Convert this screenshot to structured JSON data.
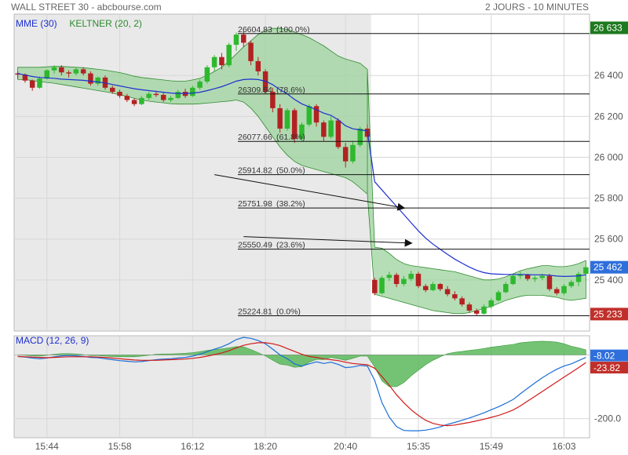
{
  "header": {
    "title": "WALL STREET 30 - abcbourse.com",
    "period": "2 JOURS - 10 MINUTES"
  },
  "colors": {
    "up": "#2eb82e",
    "down": "#b22222",
    "ema": "#1e2fd1",
    "keltner": "#2e8b2e",
    "keltner_fill": "#9ed39e",
    "macd": "#1a6fd6",
    "signal": "#d11a1a",
    "hist": "#5cb85c",
    "shade": "#e9e9e9",
    "last_price_bg": "#2e6fdc",
    "fib_top_bg": "#1e7a1e",
    "fib_bottom_bg": "#c0302a"
  },
  "chart_data": [
    {
      "type": "candlestick",
      "legend": [
        {
          "label": "MME (30)",
          "color": "#1e2fd1"
        },
        {
          "label": "KELTNER (20, 2)",
          "color": "#2e8b2e"
        }
      ],
      "ylim": [
        25150,
        26700
      ],
      "y_ticks": [
        {
          "value": 26400,
          "label": "26 400"
        },
        {
          "value": 26200,
          "label": "26 200"
        },
        {
          "value": 26000,
          "label": "26 000"
        },
        {
          "value": 25800,
          "label": "25 800"
        },
        {
          "value": 25600,
          "label": "25 600"
        },
        {
          "value": 25400,
          "label": "25 400"
        }
      ],
      "x_ticks": [
        "15:44",
        "15:58",
        "16:12",
        "18:20",
        "20:40",
        "15:35",
        "15:49",
        "16:03"
      ],
      "fibonacci": [
        {
          "value": 26604.83,
          "label": "26604.83",
          "pct": "(100.0%)"
        },
        {
          "value": 26309.54,
          "label": "26309.54",
          "pct": "(78.6%)"
        },
        {
          "value": 26077.66,
          "label": "26077.66",
          "pct": "(61.8%)"
        },
        {
          "value": 25914.82,
          "label": "25914.82",
          "pct": "(50.0%)"
        },
        {
          "value": 25751.98,
          "label": "25751.98",
          "pct": "(38.2%)"
        },
        {
          "value": 25550.49,
          "label": "25550.49",
          "pct": "(23.6%)"
        },
        {
          "value": 25224.81,
          "label": "25224.81",
          "pct": "(0.0%)"
        }
      ],
      "price_labels": [
        {
          "value": 26633,
          "label": "26 633"
        },
        {
          "value": 25462,
          "label": "25 462"
        },
        {
          "value": 25233,
          "label": "25 233"
        }
      ],
      "candles": [
        [
          26410,
          26420,
          26385,
          26405
        ],
        [
          26405,
          26410,
          26365,
          26375
        ],
        [
          26375,
          26380,
          26325,
          26340
        ],
        [
          26340,
          26395,
          26335,
          26385
        ],
        [
          26385,
          26430,
          26380,
          26425
        ],
        [
          26425,
          26450,
          26410,
          26440
        ],
        [
          26440,
          26450,
          26400,
          26415
        ],
        [
          26415,
          26425,
          26390,
          26410
        ],
        [
          26410,
          26440,
          26400,
          26430
        ],
        [
          26430,
          26440,
          26400,
          26410
        ],
        [
          26410,
          26420,
          26350,
          26360
        ],
        [
          26360,
          26395,
          26350,
          26390
        ],
        [
          26390,
          26400,
          26330,
          26340
        ],
        [
          26340,
          26350,
          26310,
          26320
        ],
        [
          26320,
          26330,
          26290,
          26300
        ],
        [
          26300,
          26310,
          26270,
          26280
        ],
        [
          26280,
          26290,
          26250,
          26260
        ],
        [
          26260,
          26300,
          26255,
          26290
        ],
        [
          26290,
          26320,
          26280,
          26310
        ],
        [
          26310,
          26325,
          26295,
          26305
        ],
        [
          26305,
          26315,
          26270,
          26280
        ],
        [
          26280,
          26300,
          26270,
          26290
        ],
        [
          26290,
          26330,
          26285,
          26320
        ],
        [
          26320,
          26335,
          26290,
          26300
        ],
        [
          26300,
          26350,
          26295,
          26340
        ],
        [
          26340,
          26380,
          26330,
          26370
        ],
        [
          26370,
          26450,
          26360,
          26440
        ],
        [
          26440,
          26500,
          26420,
          26490
        ],
        [
          26490,
          26510,
          26430,
          26450
        ],
        [
          26450,
          26560,
          26440,
          26550
        ],
        [
          26550,
          26610,
          26520,
          26600
        ],
        [
          26600,
          26620,
          26540,
          26560
        ],
        [
          26560,
          26570,
          26450,
          26470
        ],
        [
          26470,
          26490,
          26400,
          26420
        ],
        [
          26420,
          26430,
          26310,
          26320
        ],
        [
          26320,
          26340,
          26220,
          26240
        ],
        [
          26240,
          26260,
          26120,
          26140
        ],
        [
          26140,
          26240,
          26130,
          26230
        ],
        [
          26230,
          26240,
          26070,
          26090
        ],
        [
          26090,
          26170,
          26080,
          26160
        ],
        [
          26160,
          26260,
          26150,
          26250
        ],
        [
          26250,
          26260,
          26150,
          26170
        ],
        [
          26170,
          26180,
          26080,
          26100
        ],
        [
          26100,
          26200,
          26090,
          26180
        ],
        [
          26180,
          26190,
          26040,
          26050
        ],
        [
          26050,
          26070,
          25950,
          25980
        ],
        [
          25980,
          26080,
          25970,
          26060
        ],
        [
          26060,
          26150,
          26050,
          26140
        ],
        [
          26140,
          26160,
          26080,
          26100
        ],
        [
          25400,
          25410,
          25325,
          25335
        ],
        [
          25335,
          25420,
          25330,
          25410
        ],
        [
          25410,
          25440,
          25395,
          25425
        ],
        [
          25425,
          25435,
          25365,
          25380
        ],
        [
          25380,
          25420,
          25370,
          25405
        ],
        [
          25405,
          25445,
          25395,
          25430
        ],
        [
          25430,
          25440,
          25360,
          25370
        ],
        [
          25370,
          25380,
          25340,
          25350
        ],
        [
          25350,
          25390,
          25345,
          25380
        ],
        [
          25380,
          25385,
          25345,
          25355
        ],
        [
          25355,
          25370,
          25320,
          25330
        ],
        [
          25330,
          25345,
          25300,
          25310
        ],
        [
          25310,
          25320,
          25270,
          25280
        ],
        [
          25280,
          25290,
          25240,
          25250
        ],
        [
          25250,
          25260,
          25225,
          25235
        ],
        [
          25235,
          25280,
          25230,
          25270
        ],
        [
          25270,
          25310,
          25260,
          25300
        ],
        [
          25300,
          25350,
          25295,
          25340
        ],
        [
          25340,
          25390,
          25335,
          25380
        ],
        [
          25380,
          25430,
          25375,
          25420
        ],
        [
          25420,
          25440,
          25405,
          25425
        ],
        [
          25425,
          25430,
          25395,
          25405
        ],
        [
          25405,
          25420,
          25390,
          25410
        ],
        [
          25410,
          25430,
          25400,
          25420
        ],
        [
          25420,
          25430,
          25345,
          25355
        ],
        [
          25355,
          25365,
          25325,
          25335
        ],
        [
          25335,
          25380,
          25325,
          25370
        ],
        [
          25370,
          25400,
          25360,
          25390
        ],
        [
          25390,
          25440,
          25370,
          25430
        ],
        [
          25430,
          25475,
          25420,
          25462
        ]
      ],
      "ema30": [
        26410,
        26402,
        26395,
        26390,
        26388,
        26386,
        26382,
        26380,
        26378,
        26376,
        26372,
        26368,
        26363,
        26356,
        26349,
        26342,
        26335,
        26330,
        26326,
        26322,
        26318,
        26314,
        26312,
        26312,
        26314,
        26318,
        26326,
        26335,
        26345,
        26358,
        26372,
        26380,
        26382,
        26380,
        26372,
        26355,
        26330,
        26310,
        26283,
        26261,
        26247,
        26232,
        26216,
        26205,
        26183,
        26154,
        26139,
        26134,
        26129,
        25880,
        25840,
        25800,
        25760,
        25720,
        25680,
        25640,
        25605,
        25575,
        25550,
        25525,
        25502,
        25482,
        25463,
        25447,
        25436,
        25430,
        25428,
        25427,
        25427,
        25427,
        25426,
        25425,
        25425,
        25423,
        25419,
        25417,
        25418,
        25420,
        25425
      ],
      "keltner_upper": [
        26440,
        26440,
        26440,
        26440,
        26442,
        26444,
        26444,
        26442,
        26440,
        26438,
        26434,
        26430,
        26426,
        26420,
        26414,
        26406,
        26396,
        26390,
        26386,
        26382,
        26378,
        26374,
        26372,
        26372,
        26378,
        26386,
        26400,
        26420,
        26440,
        26470,
        26505,
        26540,
        26570,
        26600,
        26620,
        26630,
        26630,
        26625,
        26612,
        26600,
        26585,
        26565,
        26545,
        26520,
        26495,
        26480,
        26470,
        26460,
        26430,
        25560,
        25555,
        25530,
        25500,
        25480,
        25470,
        25465,
        25460,
        25455,
        25450,
        25445,
        25440,
        25430,
        25420,
        25410,
        25400,
        25400,
        25405,
        25415,
        25430,
        25445,
        25455,
        25462,
        25470,
        25470,
        25465,
        25465,
        25470,
        25480,
        25495
      ],
      "keltner_lower": [
        26380,
        26380,
        26375,
        26370,
        26366,
        26362,
        26356,
        26350,
        26344,
        26338,
        26332,
        26326,
        26320,
        26314,
        26306,
        26298,
        26288,
        26280,
        26274,
        26270,
        26266,
        26262,
        26260,
        26260,
        26260,
        26262,
        26265,
        26268,
        26272,
        26275,
        26280,
        26270,
        26240,
        26200,
        26150,
        26100,
        26050,
        26010,
        25980,
        25960,
        25950,
        25940,
        25930,
        25920,
        25910,
        25900,
        25880,
        25850,
        25820,
        25330,
        25320,
        25310,
        25300,
        25290,
        25280,
        25270,
        25260,
        25250,
        25245,
        25240,
        25235,
        25235,
        25240,
        25250,
        25260,
        25270,
        25285,
        25300,
        25310,
        25320,
        25325,
        25325,
        25325,
        25320,
        25315,
        25305,
        25300,
        25305,
        25310
      ],
      "sessions": [
        {
          "start_index": 0,
          "end_index": 48,
          "shaded": true
        },
        {
          "start_index": 49,
          "end_index": 78,
          "shaded": false
        }
      ],
      "arrows": [
        {
          "from": [
            25914.82,
            27
          ],
          "to": [
            25751.98,
            53
          ]
        },
        {
          "from": [
            25612,
            31
          ],
          "to": [
            25580,
            54
          ]
        }
      ]
    },
    {
      "type": "macd",
      "title": "MACD (12, 26, 9)",
      "ylim": [
        -260,
        60
      ],
      "y_ticks": [
        {
          "value": -200,
          "label": "-200.0"
        }
      ],
      "value_labels": [
        {
          "value": -8.02,
          "label": "-8.02"
        },
        {
          "value": -23.82,
          "label": "-23.82"
        }
      ],
      "macd": [
        -5,
        -7,
        -10,
        -12,
        -10,
        -6,
        -3,
        -2,
        -3,
        -5,
        -8,
        -9,
        -12,
        -15,
        -18,
        -20,
        -22,
        -21,
        -18,
        -15,
        -13,
        -12,
        -10,
        -8,
        -4,
        2,
        10,
        18,
        25,
        35,
        48,
        55,
        52,
        45,
        35,
        18,
        0,
        -12,
        -28,
        -35,
        -28,
        -22,
        -27,
        -23,
        -30,
        -40,
        -38,
        -33,
        -35,
        -80,
        -150,
        -195,
        -225,
        -237,
        -238,
        -238,
        -236,
        -232,
        -226,
        -218,
        -212,
        -205,
        -198,
        -190,
        -182,
        -172,
        -163,
        -152,
        -140,
        -122,
        -105,
        -88,
        -72,
        -58,
        -45,
        -35,
        -28,
        -18,
        -8.02
      ],
      "signal": [
        -5,
        -6,
        -7,
        -8,
        -9,
        -8,
        -7,
        -6,
        -6,
        -6,
        -6,
        -7,
        -8,
        -10,
        -12,
        -14,
        -16,
        -17,
        -17,
        -17,
        -16,
        -15,
        -14,
        -13,
        -11,
        -8,
        -4,
        1,
        6,
        13,
        22,
        30,
        35,
        38,
        38,
        35,
        29,
        20,
        11,
        2,
        -5,
        -8,
        -12,
        -15,
        -18,
        -23,
        -27,
        -29,
        -31,
        -42,
        -68,
        -95,
        -125,
        -150,
        -172,
        -190,
        -205,
        -215,
        -220,
        -222,
        -220,
        -216,
        -212,
        -207,
        -202,
        -196,
        -190,
        -182,
        -173,
        -160,
        -145,
        -130,
        -115,
        -100,
        -85,
        -70,
        -55,
        -40,
        -23.82
      ],
      "histogram": [
        0,
        -1,
        -3,
        -4,
        -1,
        2,
        4,
        4,
        3,
        1,
        -2,
        -2,
        -4,
        -5,
        -6,
        -6,
        -6,
        -4,
        -1,
        2,
        3,
        3,
        4,
        5,
        7,
        10,
        14,
        17,
        19,
        22,
        26,
        25,
        17,
        7,
        -3,
        -17,
        -29,
        -32,
        -39,
        -37,
        -23,
        -14,
        -15,
        -8,
        -12,
        -17,
        -11,
        -4,
        -4,
        -38,
        -82,
        -100,
        -100,
        -87,
        -66,
        -48,
        -31,
        -17,
        -6,
        4,
        8,
        11,
        14,
        17,
        20,
        24,
        27,
        30,
        33,
        38,
        40,
        42,
        43,
        42,
        40,
        35,
        27,
        22,
        15.8
      ]
    }
  ]
}
